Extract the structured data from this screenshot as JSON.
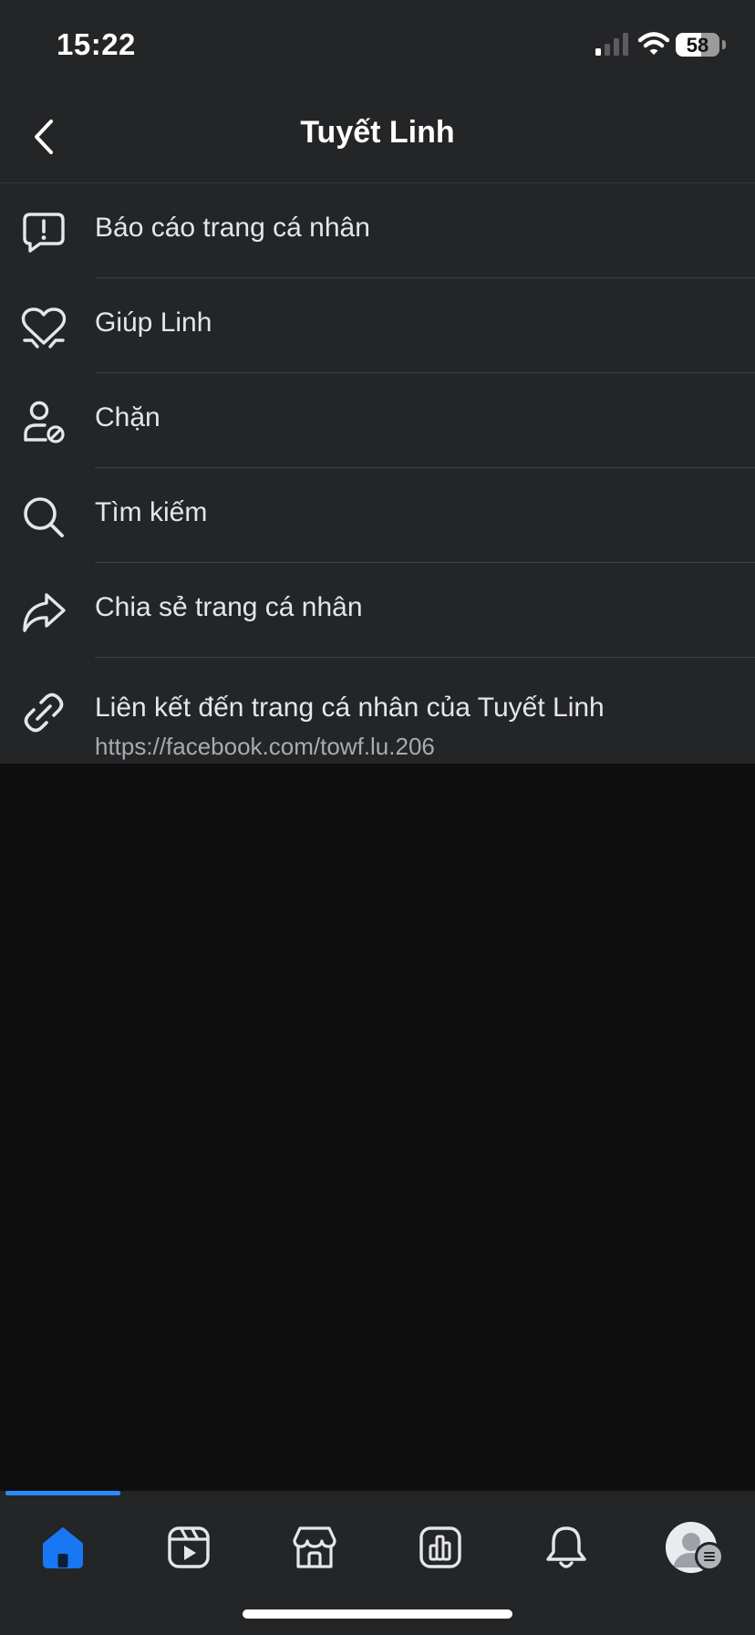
{
  "status_bar": {
    "time": "15:22",
    "battery_percent": "58",
    "battery_level": 0.58,
    "icons": [
      "signal-icon",
      "wifi-icon",
      "battery-icon"
    ]
  },
  "header": {
    "title": "Tuyết Linh",
    "back_icon": "chevron-left-icon"
  },
  "menu": {
    "items": [
      {
        "label": "Báo cáo trang cá nhân",
        "icon": "report-icon"
      },
      {
        "label": "Giúp Linh",
        "icon": "heart-icon"
      },
      {
        "label": "Chặn",
        "icon": "block-user-icon"
      },
      {
        "label": "Tìm kiếm",
        "icon": "search-icon"
      },
      {
        "label": "Chia sẻ trang cá nhân",
        "icon": "share-icon"
      },
      {
        "label": "Liên kết đến trang cá nhân của Tuyết Linh",
        "sublabel": "https://facebook.com/towf.lu.206",
        "icon": "link-icon"
      }
    ]
  },
  "bottom_nav": {
    "tabs": [
      "home-icon",
      "video-icon",
      "marketplace-icon",
      "dashboard-icon",
      "bell-icon",
      "profile-avatar"
    ],
    "active_tab": "home-icon"
  },
  "colors": {
    "surface": "#242527",
    "background": "#0f0f0f",
    "text": "#e4e6eb",
    "secondary_text": "#a8abaf",
    "accent": "#2d88ff",
    "divider": "#3e4042"
  }
}
